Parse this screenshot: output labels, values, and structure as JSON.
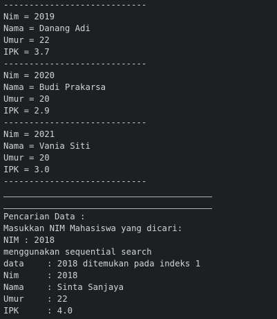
{
  "console": {
    "separator": "----------------------------",
    "records": [
      {
        "nim": "Nim = 2019",
        "nama": "Nama = Danang Adi",
        "umur": "Umur = 22",
        "ipk": "IPK = 3.7"
      },
      {
        "nim": "Nim = 2020",
        "nama": "Nama = Budi Prakarsa",
        "umur": "Umur = 20",
        "ipk": "IPK = 2.9"
      },
      {
        "nim": "Nim = 2021",
        "nama": "Nama = Vania Siti",
        "umur": "Umur = 20",
        "ipk": "IPK = 3.0"
      }
    ],
    "search": {
      "heading": "Pencarian Data :",
      "prompt": "Masukkan NIM Mahasiswa yang dicari:",
      "nim_input": "NIM : 2018",
      "method": "menggunakan sequential search",
      "result": {
        "data_label": "data",
        "data_value": ": 2018 ditemukan pada indeks 1",
        "nim_label": "Nim",
        "nim_value": ": 2018",
        "nama_label": "Nama",
        "nama_value": ": Sinta Sanjaya",
        "umur_label": "Umur",
        "umur_value": ": 22",
        "ipk_label": "IPK",
        "ipk_value": ": 4.0"
      }
    }
  }
}
